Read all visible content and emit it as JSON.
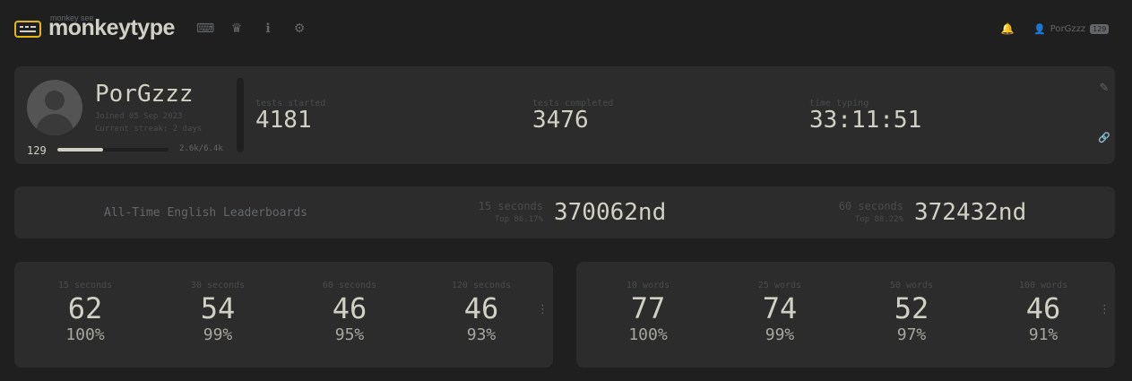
{
  "header": {
    "top_text": "monkey see",
    "brand": "monkeytype",
    "nav": [
      {
        "name": "keyboard-icon",
        "glyph": "⌨"
      },
      {
        "name": "crown-icon",
        "glyph": "♛"
      },
      {
        "name": "info-icon",
        "glyph": "ℹ"
      },
      {
        "name": "gear-icon",
        "glyph": "⚙"
      }
    ],
    "bell_glyph": "🔔",
    "user_glyph": "👤",
    "username": "PorGzzz",
    "level_badge": "129"
  },
  "profile": {
    "name": "PorGzzz",
    "joined": "Joined 05 Sep 2023",
    "streak": "Current streak: 2 days",
    "level": "129",
    "xp_text": "2.6k/6.4k",
    "xp_fraction": 0.41,
    "stats": [
      {
        "label": "tests started",
        "value": "4181"
      },
      {
        "label": "tests completed",
        "value": "3476"
      },
      {
        "label": "time typing",
        "value": "33:11:51"
      }
    ],
    "edit_glyph": "✎",
    "link_glyph": "🔗"
  },
  "leaderboards": {
    "title": "All-Time English Leaderboards",
    "entries": [
      {
        "label": "15 seconds",
        "top": "Top 86.17%",
        "rank": "370062nd"
      },
      {
        "label": "60 seconds",
        "top": "Top 88.22%",
        "rank": "372432nd"
      }
    ]
  },
  "pbs_time": [
    {
      "label": "15 seconds",
      "wpm": "62",
      "acc": "100%"
    },
    {
      "label": "30 seconds",
      "wpm": "54",
      "acc": "99%"
    },
    {
      "label": "60 seconds",
      "wpm": "46",
      "acc": "95%"
    },
    {
      "label": "120 seconds",
      "wpm": "46",
      "acc": "93%"
    }
  ],
  "pbs_words": [
    {
      "label": "10 words",
      "wpm": "77",
      "acc": "100%"
    },
    {
      "label": "25 words",
      "wpm": "74",
      "acc": "99%"
    },
    {
      "label": "50 words",
      "wpm": "52",
      "acc": "97%"
    },
    {
      "label": "100 words",
      "wpm": "46",
      "acc": "91%"
    }
  ],
  "more_glyph": "⋮"
}
